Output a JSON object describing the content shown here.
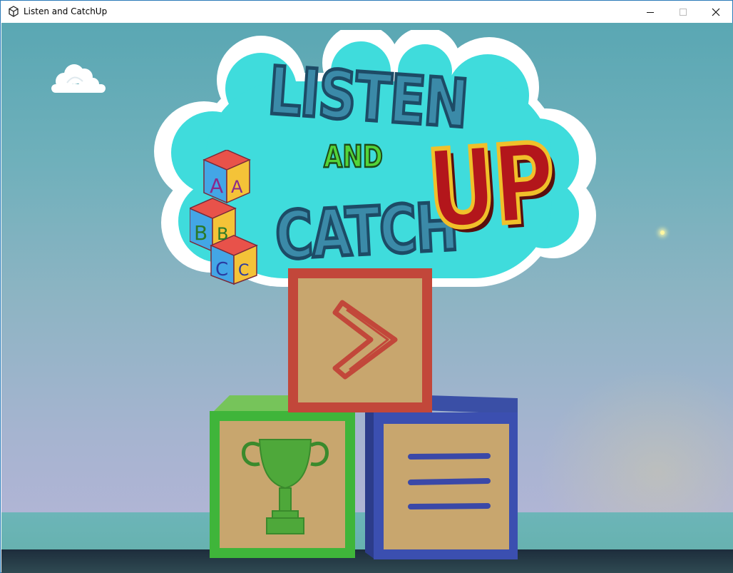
{
  "window": {
    "title": "Listen and CatchUp",
    "icon": "unity-logo-icon",
    "controls": [
      "minimize-icon",
      "maximize-icon",
      "close-icon"
    ]
  },
  "logo": {
    "line1": "LISTEN",
    "line2": "AND",
    "line3": "CATCH",
    "line4": "UP",
    "blocks": {
      "top": [
        "A",
        "A"
      ],
      "middle": [
        "B",
        "B"
      ],
      "bottom": [
        "C",
        "C"
      ]
    }
  },
  "menu": {
    "play": {
      "icon": "play-chevron-icon",
      "color": "#c2473a"
    },
    "achievements": {
      "icon": "trophy-icon",
      "color": "#3fb53a"
    },
    "options": {
      "icon": "hamburger-menu-icon",
      "color": "#3b4fb0"
    }
  },
  "colors": {
    "cloud_fill": "#3fdcdc",
    "block_face": "#c8a66e",
    "sky_top": "#5aa7b3",
    "sky_bottom": "#b2b5d6"
  }
}
